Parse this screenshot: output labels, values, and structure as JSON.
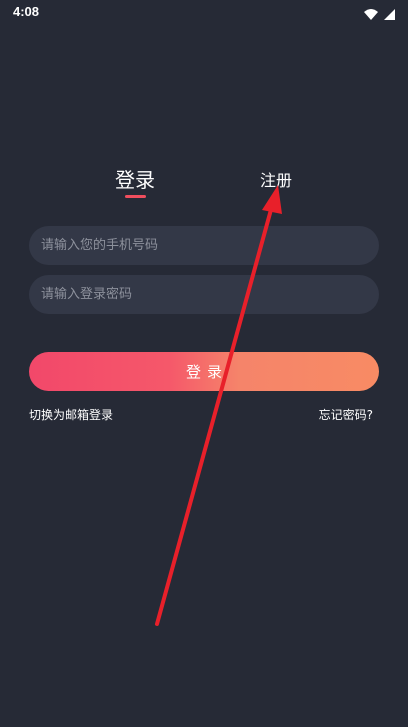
{
  "status_bar": {
    "time": "4:08",
    "icons": [
      "wifi-icon",
      "cellular-signal-icon"
    ]
  },
  "tabs": {
    "login_label": "登录",
    "register_label": "注册",
    "active": "login"
  },
  "form": {
    "phone_placeholder": "请输入您的手机号码",
    "password_placeholder": "请输入登录密码",
    "submit_label": "登录"
  },
  "links": {
    "switch_email": "切换为邮箱登录",
    "forgot_password": "忘记密码?"
  },
  "colors": {
    "background": "#262a36",
    "input_background": "#333847",
    "accent": "#f04e5e",
    "button_gradient_start": "#f2486a",
    "button_gradient_end": "#f88b64",
    "annotation": "#e8202a"
  }
}
